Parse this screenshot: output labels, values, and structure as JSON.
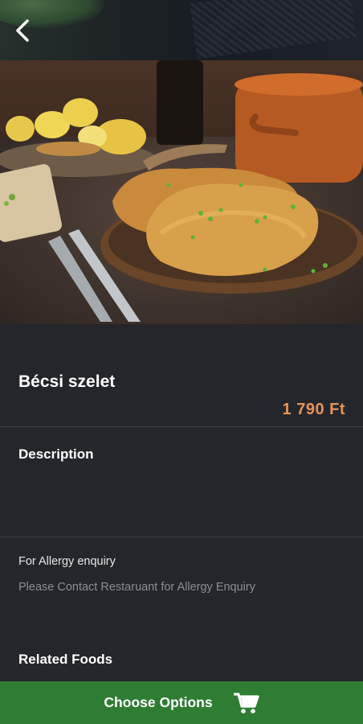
{
  "dish": {
    "name": "Bécsi szelet",
    "price": "1 790 Ft"
  },
  "sections": {
    "description_title": "Description",
    "allergy_label": "For Allergy enquiry",
    "allergy_note": "Please Contact Restaruant for Allergy Enquiry",
    "related_title": "Related Foods"
  },
  "footer": {
    "choose_label": "Choose Options",
    "cart_icon": "shopping-cart-icon"
  },
  "colors": {
    "accent_price": "#e89356",
    "cta_green": "#2f7d33",
    "background": "#24262b"
  }
}
